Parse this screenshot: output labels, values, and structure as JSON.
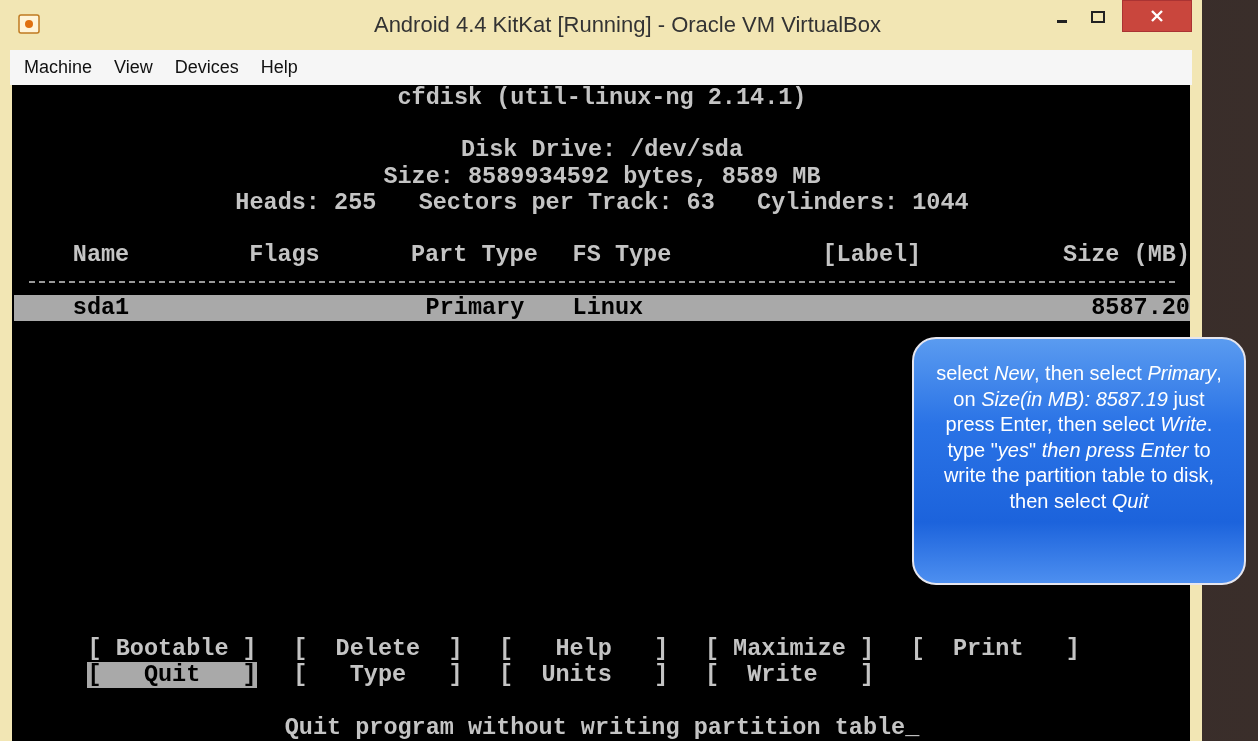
{
  "window": {
    "title": "Android 4.4 KitKat [Running] - Oracle VM VirtualBox"
  },
  "menu": [
    "Machine",
    "View",
    "Devices",
    "Help"
  ],
  "terminal": {
    "program_title": "cfdisk (util-linux-ng 2.14.1)",
    "disk_info": [
      "Disk Drive: /dev/sda",
      "Size: 8589934592 bytes, 8589 MB",
      "Heads: 255   Sectors per Track: 63   Cylinders: 1044"
    ],
    "columns": [
      "Name",
      "Flags",
      "Part Type",
      "FS Type",
      "[Label]",
      "Size (MB)"
    ],
    "partitions": [
      {
        "name": "sda1",
        "part_type": "Primary",
        "fs_type": "Linux",
        "size": "8587.20",
        "selected": true
      }
    ],
    "commands": [
      [
        {
          "label": "[ Bootable ]",
          "selected": false
        },
        {
          "label": "[  Delete  ]",
          "selected": false
        },
        {
          "label": "[   Help   ]",
          "selected": false
        },
        {
          "label": "[ Maximize ]",
          "selected": false
        },
        {
          "label": "[  Print   ]",
          "selected": false
        }
      ],
      [
        {
          "label": "[   Quit   ]",
          "selected": true
        },
        {
          "label": "[   Type   ]",
          "selected": false
        },
        {
          "label": "[  Units   ]",
          "selected": false
        },
        {
          "label": "[  Write   ]",
          "selected": false
        }
      ]
    ],
    "status": "Quit program without writing partition table_"
  },
  "callout": {
    "text": "select *New*, then select *Primary*, on *Size(in MB): 8587.19* just press Enter, then select *Write*. type \"*yes*\"  *then press Enter* to write the partition table to disk, then select *Quit*"
  }
}
